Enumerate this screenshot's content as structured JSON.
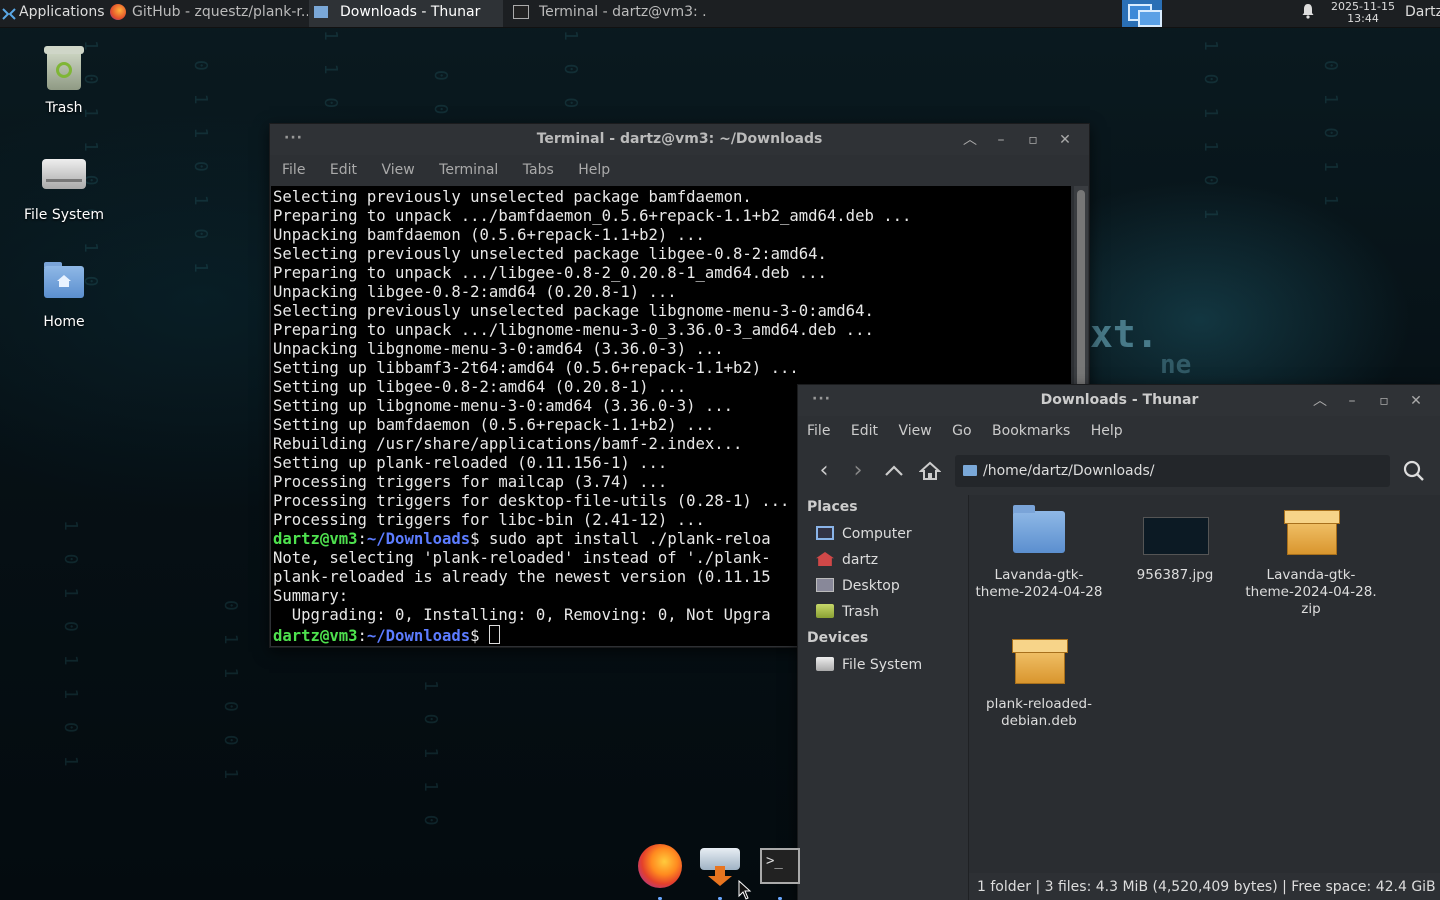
{
  "top_panel": {
    "applications_label": "Applications",
    "tasks": [
      {
        "label": "GitHub - zquestz/plank-r...",
        "active": false
      },
      {
        "label": "Downloads - Thunar",
        "active": true
      },
      {
        "label": "Terminal - dartz@vm3: ...",
        "active": false
      }
    ],
    "clock_date": "2025-11-15",
    "clock_time": "13:44",
    "user": "Dartz"
  },
  "desktop_icons": [
    {
      "label": "Trash",
      "icon": "trash-icon"
    },
    {
      "label": "File System",
      "icon": "drive-icon"
    },
    {
      "label": "Home",
      "icon": "home-folder-icon"
    }
  ],
  "terminal": {
    "title": "Terminal - dartz@vm3: ~/Downloads",
    "menu": [
      "File",
      "Edit",
      "View",
      "Terminal",
      "Tabs",
      "Help"
    ],
    "lines": [
      "Selecting previously unselected package bamfdaemon.",
      "Preparing to unpack .../bamfdaemon_0.5.6+repack-1.1+b2_amd64.deb ...",
      "Unpacking bamfdaemon (0.5.6+repack-1.1+b2) ...",
      "Selecting previously unselected package libgee-0.8-2:amd64.",
      "Preparing to unpack .../libgee-0.8-2_0.20.8-1_amd64.deb ...",
      "Unpacking libgee-0.8-2:amd64 (0.20.8-1) ...",
      "Selecting previously unselected package libgnome-menu-3-0:amd64.",
      "Preparing to unpack .../libgnome-menu-3-0_3.36.0-3_amd64.deb ...",
      "Unpacking libgnome-menu-3-0:amd64 (3.36.0-3) ...",
      "Setting up libbamf3-2t64:amd64 (0.5.6+repack-1.1+b2) ...",
      "Setting up libgee-0.8-2:amd64 (0.20.8-1) ...",
      "Setting up libgnome-menu-3-0:amd64 (3.36.0-3) ...",
      "Setting up bamfdaemon (0.5.6+repack-1.1+b2) ...",
      "Rebuilding /usr/share/applications/bamf-2.index...",
      "Setting up plank-reloaded (0.11.156-1) ...",
      "Processing triggers for mailcap (3.74) ...",
      "Processing triggers for desktop-file-utils (0.28-1) ...",
      "Processing triggers for libc-bin (2.41-12) ..."
    ],
    "prompt_user": "dartz@vm3",
    "prompt_path": "~/Downloads",
    "prompt_symbol": "$",
    "command": " sudo apt install ./plank-reloa",
    "output_after": [
      "Note, selecting 'plank-reloaded' instead of './plank-",
      "plank-reloaded is already the newest version (0.11.15",
      "Summary:",
      "  Upgrading: 0, Installing: 0, Removing: 0, Not Upgra"
    ]
  },
  "thunar": {
    "title": "Downloads - Thunar",
    "menu": [
      "File",
      "Edit",
      "View",
      "Go",
      "Bookmarks",
      "Help"
    ],
    "location": "/home/dartz/Downloads/",
    "places_heading": "Places",
    "places": [
      "Computer",
      "dartz",
      "Desktop",
      "Trash"
    ],
    "devices_heading": "Devices",
    "devices": [
      "File System"
    ],
    "files": [
      {
        "name": "Lavanda-gtk-\ntheme-2024-04-28",
        "type": "folder"
      },
      {
        "name": "956387.jpg",
        "type": "image"
      },
      {
        "name": "Lavanda-gtk-\ntheme-2024-04-28.\nzip",
        "type": "archive"
      },
      {
        "name": "plank-reloaded-\ndebian.deb",
        "type": "archive"
      }
    ],
    "status": "1 folder  |  3 files: 4.3 MiB (4,520,409 bytes)  |  Free space: 42.4 GiB"
  },
  "dock": {
    "items": [
      "firefox-icon",
      "installer-icon",
      "terminal-icon"
    ]
  },
  "colors": {
    "panel_bg": "#1c1f22",
    "window_bg": "#2d3034",
    "prompt_green": "#4ee14e",
    "prompt_blue": "#5c7cff",
    "workspace_blue": "#2a6fb5"
  }
}
